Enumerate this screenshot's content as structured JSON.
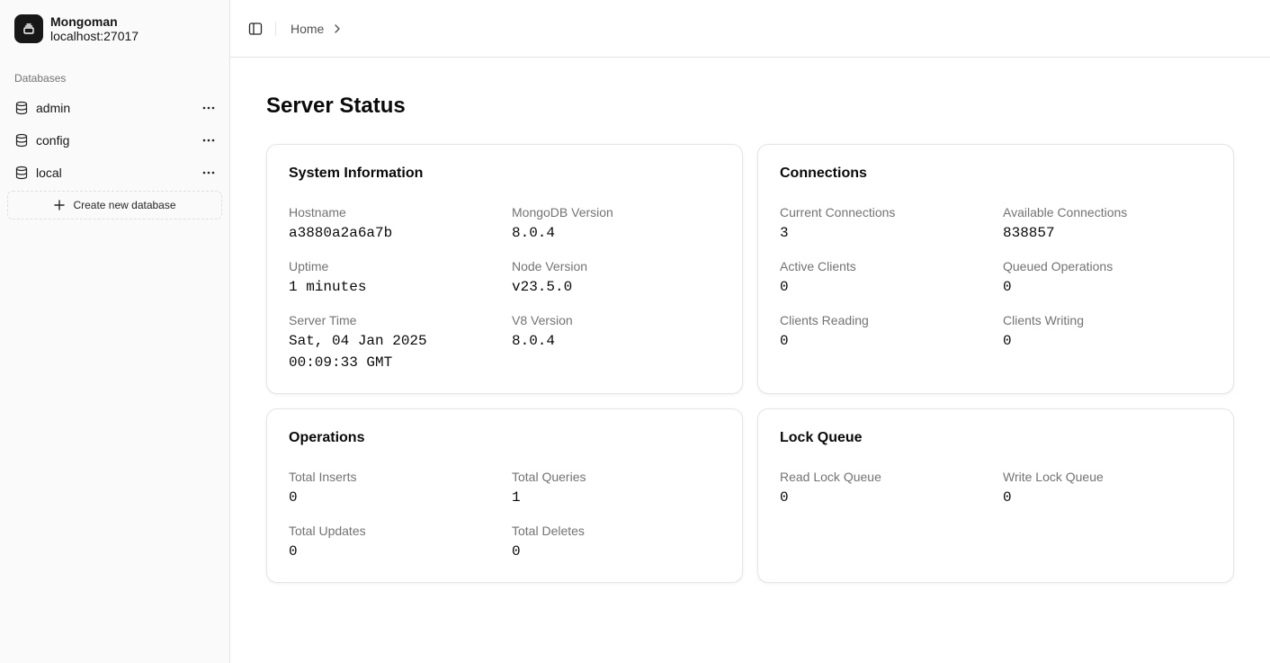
{
  "brand": {
    "name": "Mongoman",
    "host": "localhost:27017"
  },
  "sidebar": {
    "section_label": "Databases",
    "databases": [
      {
        "label": "admin"
      },
      {
        "label": "config"
      },
      {
        "label": "local"
      }
    ],
    "create_label": "Create new database"
  },
  "breadcrumb": {
    "home": "Home"
  },
  "page": {
    "title": "Server Status"
  },
  "cards": {
    "system": {
      "title": "System Information",
      "fields": [
        {
          "label": "Hostname",
          "value": "a3880a2a6a7b"
        },
        {
          "label": "MongoDB Version",
          "value": "8.0.4"
        },
        {
          "label": "Uptime",
          "value": "1 minutes"
        },
        {
          "label": "Node Version",
          "value": "v23.5.0"
        },
        {
          "label": "Server Time",
          "value": "Sat, 04 Jan 2025 00:09:33 GMT"
        },
        {
          "label": "V8 Version",
          "value": "8.0.4"
        }
      ]
    },
    "connections": {
      "title": "Connections",
      "fields": [
        {
          "label": "Current Connections",
          "value": "3"
        },
        {
          "label": "Available Connections",
          "value": "838857"
        },
        {
          "label": "Active Clients",
          "value": "0"
        },
        {
          "label": "Queued Operations",
          "value": "0"
        },
        {
          "label": "Clients Reading",
          "value": "0"
        },
        {
          "label": "Clients Writing",
          "value": "0"
        }
      ]
    },
    "operations": {
      "title": "Operations",
      "fields": [
        {
          "label": "Total Inserts",
          "value": "0"
        },
        {
          "label": "Total Queries",
          "value": "1"
        },
        {
          "label": "Total Updates",
          "value": "0"
        },
        {
          "label": "Total Deletes",
          "value": "0"
        }
      ]
    },
    "lock_queue": {
      "title": "Lock Queue",
      "fields": [
        {
          "label": "Read Lock Queue",
          "value": "0"
        },
        {
          "label": "Write Lock Queue",
          "value": "0"
        }
      ]
    }
  },
  "icons": {
    "brand": "layers-icon",
    "database": "database-icon",
    "more": "more-horizontal-icon",
    "plus": "plus-icon",
    "sidebar_toggle": "panel-left-icon",
    "chevron": "chevron-right-icon"
  }
}
